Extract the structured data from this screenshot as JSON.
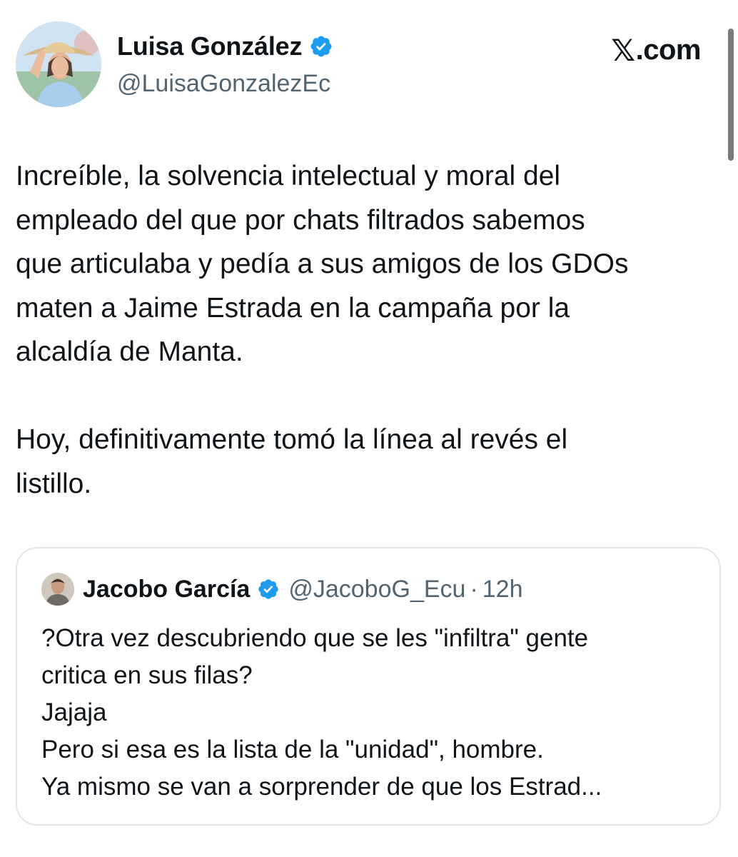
{
  "colors": {
    "text_primary": "#0f1419",
    "text_secondary": "#536471",
    "verified_blue": "#1d9bf0",
    "card_border": "#e1e6ea"
  },
  "header": {
    "avatar_icon": "profile-photo",
    "display_name": "Luisa González",
    "verified_icon": "verified-badge-icon",
    "handle": "@LuisaGonzalezEc",
    "brand_mark": "𝕏",
    "brand_text": ".com"
  },
  "tweet": {
    "paragraph_1": "Increíble, la solvencia intelectual y moral del\nempleado del que por chats filtrados sabemos\nque articulaba y pedía a sus amigos de los GDOs\nmaten a Jaime Estrada en la campaña por la\nalcaldía de Manta.",
    "paragraph_2": "Hoy, definitivamente tomó la línea al revés el\nlistillo."
  },
  "quoted_tweet": {
    "avatar_icon": "profile-photo",
    "display_name": "Jacobo García",
    "verified_icon": "verified-badge-icon",
    "handle": "@JacoboG_Ecu",
    "separator": "·",
    "time": "12h",
    "lines": [
      "?Otra vez descubriendo que se les \"infiltra\" gente",
      "critica en sus filas?",
      "Jajaja",
      "Pero si esa es la lista de la \"unidad\", hombre.",
      "Ya mismo se van a sorprender de que los Estrad..."
    ]
  }
}
